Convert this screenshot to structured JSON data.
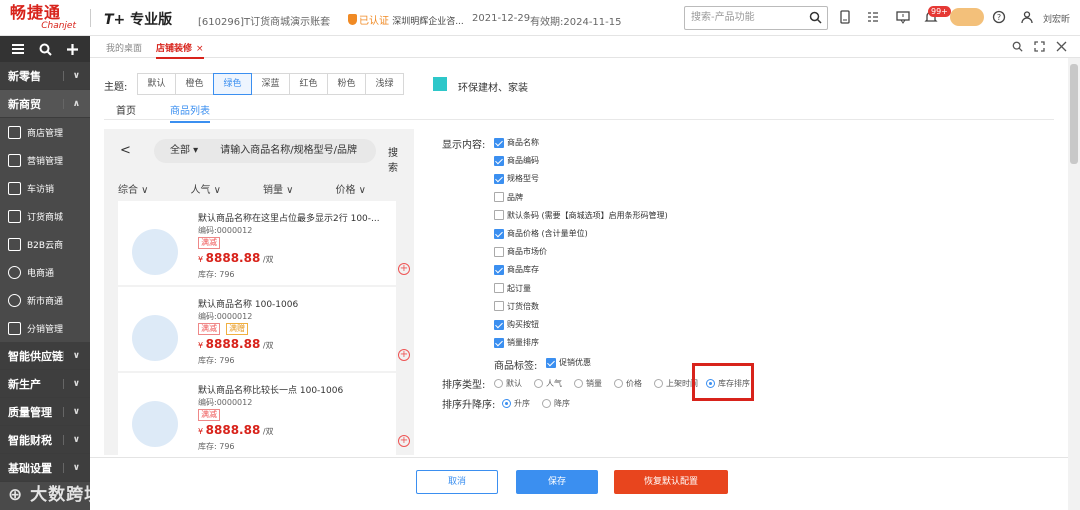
{
  "topbar": {
    "logo_cn": "畅捷通",
    "logo_en": "Chanjet",
    "edition_mark": "T+",
    "edition": "专业版",
    "account": "[610296]T订货商城演示账套",
    "cert_label": "已认证",
    "company": "深圳明辉企业咨...",
    "date": "2021-12-29",
    "expiry": "有效期:2024-11-15",
    "search_placeholder": "搜索-产品功能",
    "badge": "99+",
    "username": "刘宏昕"
  },
  "sidebar": {
    "sections": [
      {
        "label": "新零售",
        "arrow": "∨"
      },
      {
        "label": "新商贸",
        "arrow": "∧"
      }
    ],
    "items": [
      {
        "label": "商店管理",
        "icon": "store-icon"
      },
      {
        "label": "营销管理",
        "icon": "chart-icon"
      },
      {
        "label": "车访销",
        "icon": "car-icon"
      },
      {
        "label": "订货商城",
        "icon": "mall-icon"
      },
      {
        "label": "B2B云商",
        "icon": "building-icon"
      },
      {
        "label": "电商通",
        "icon": "ecommerce-icon"
      },
      {
        "label": "新市商通",
        "icon": "market-icon"
      },
      {
        "label": "分销管理",
        "icon": "distribution-icon"
      }
    ],
    "bottom_sections": [
      {
        "label": "智能供应链",
        "arrow": "∨"
      },
      {
        "label": "新生产",
        "arrow": "∨"
      },
      {
        "label": "质量管理",
        "arrow": "∨"
      },
      {
        "label": "智能财税",
        "arrow": "∨"
      },
      {
        "label": "基础设置",
        "arrow": "∨"
      }
    ]
  },
  "tabs": {
    "home": "我的桌面",
    "active": "店铺装修",
    "close": "×"
  },
  "theme": {
    "label": "主题:",
    "options": [
      "默认",
      "橙色",
      "绿色",
      "深蓝",
      "红色",
      "粉色",
      "浅绿"
    ],
    "selected_index": 2,
    "swatch_color": "#2ec7c9",
    "swatch_label": "环保建材、家装"
  },
  "subtabs": [
    "首页",
    "商品列表"
  ],
  "preview": {
    "back": "<",
    "scope": "全部 ▾",
    "search_placeholder": "请输入商品名称/规格型号/品牌",
    "search_button": "搜索",
    "sort": [
      "综合 ∨",
      "人气 ∨",
      "销量 ∨",
      "价格 ∨"
    ],
    "products": [
      {
        "name": "默认商品名称在这里占位最多显示2行 100-...",
        "code": "编码:0000012",
        "tags": [
          "满减"
        ],
        "price": "8888.88",
        "unit": "/双",
        "stock": "库存: 796"
      },
      {
        "name": "默认商品名称 100-1006",
        "code": "编码:0000012",
        "tags": [
          "满减",
          "满赠"
        ],
        "price": "8888.88",
        "unit": "/双",
        "stock": "库存: 796"
      },
      {
        "name": "默认商品名称比较长一点 100-1006",
        "code": "编码:0000012",
        "tags": [
          "满减"
        ],
        "price": "8888.88",
        "unit": "/双",
        "stock": "库存: 796"
      }
    ],
    "currency": "¥"
  },
  "display": {
    "label": "显示内容:",
    "options": [
      {
        "label": "商品名称",
        "checked": true
      },
      {
        "label": "商品编码",
        "checked": true
      },
      {
        "label": "规格型号",
        "checked": true
      },
      {
        "label": "品牌",
        "checked": false
      },
      {
        "label": "默认条码 (需要【商城选项】启用条形码管理)",
        "checked": false
      },
      {
        "label": "商品价格 (含计量单位)",
        "checked": true
      },
      {
        "label": "商品市场价",
        "checked": false
      },
      {
        "label": "商品库存",
        "checked": true
      },
      {
        "label": "起订量",
        "checked": false
      },
      {
        "label": "订货倍数",
        "checked": false
      },
      {
        "label": "购买按钮",
        "checked": true
      },
      {
        "label": "销量排序",
        "checked": true
      }
    ],
    "tag_label": "商品标签:",
    "tag_option": "促销优惠",
    "sort_type_label": "排序类型:",
    "sort_types": [
      "默认",
      "人气",
      "销量",
      "价格",
      "上架时间",
      "库存排序"
    ],
    "sort_type_selected": 5,
    "order_label": "排序升降序:",
    "orders": [
      "升序",
      "降序"
    ],
    "order_selected": 0
  },
  "footer": {
    "cancel": "取消",
    "save": "保存",
    "reset": "恢复默认配置"
  },
  "watermark": "大数跨境"
}
